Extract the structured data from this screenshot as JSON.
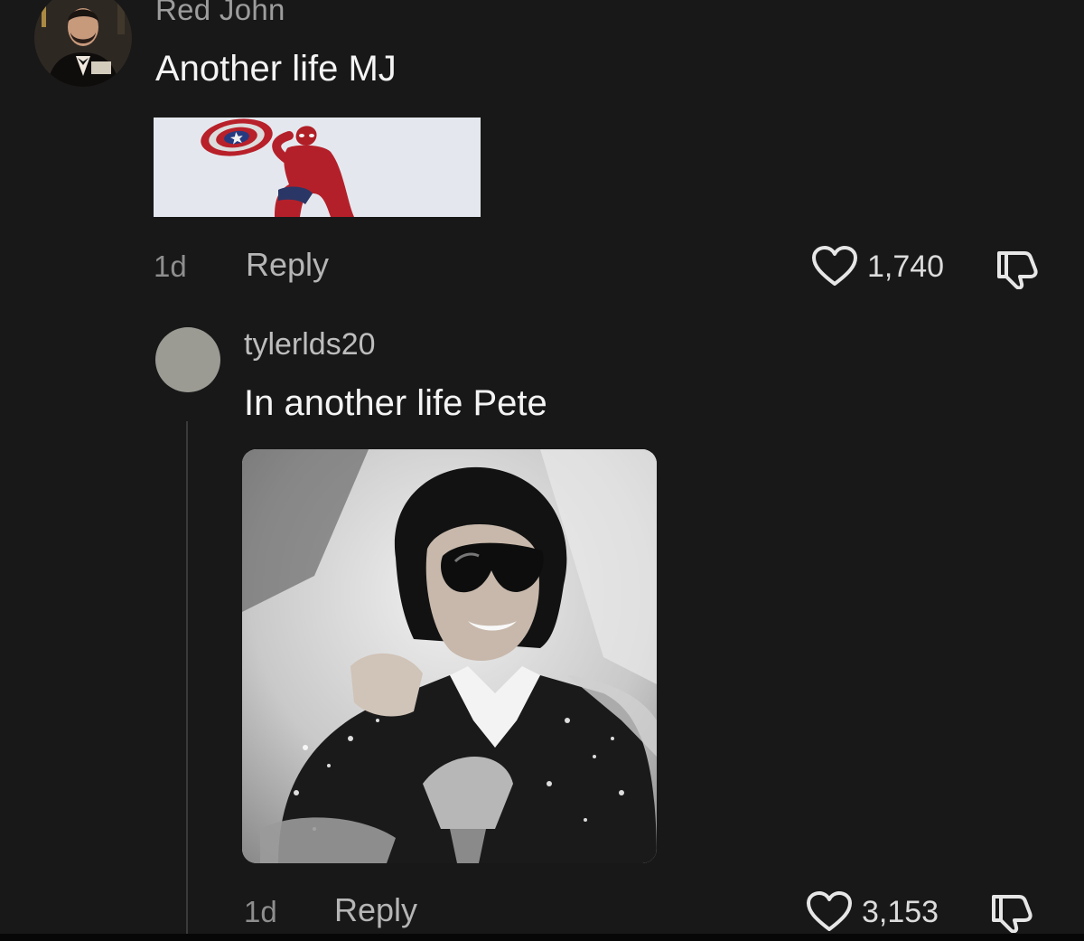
{
  "comment": {
    "username": "Red John",
    "text": "Another life MJ",
    "gif_icon": "spiderman-gif-icon",
    "time": "1d",
    "reply_label": "Reply",
    "likes": "1,740",
    "avatar_icon": "avatar-icon"
  },
  "reply": {
    "username": "tylerlds20",
    "text": "In another life Pete",
    "photo_icon": "michael-jackson-photo-icon",
    "time": "1d",
    "reply_label": "Reply",
    "likes": "3,153"
  },
  "icons": {
    "like": "heart-icon",
    "dislike": "dislike-icon"
  },
  "colors": {
    "background": "#181818",
    "text": "#f4f4f4",
    "muted": "#8e8e8e"
  }
}
